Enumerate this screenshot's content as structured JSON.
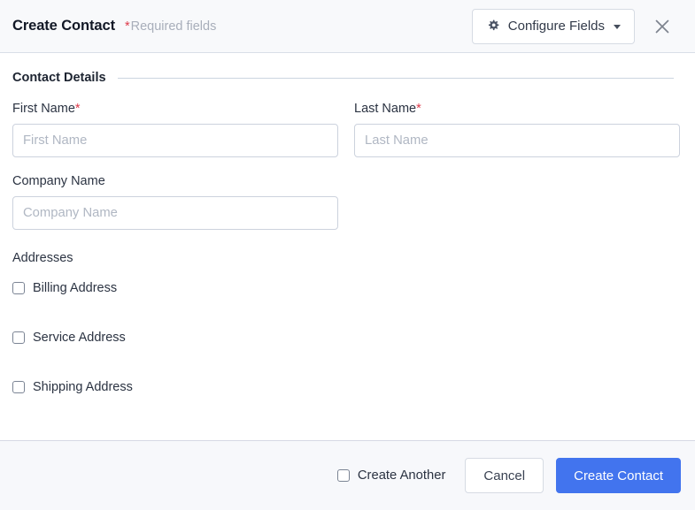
{
  "header": {
    "title": "Create Contact",
    "required_asterisk": "*",
    "required_note": "Required fields",
    "configure_label": "Configure Fields",
    "gear_icon_name": "gear-icon",
    "caret_icon_name": "chevron-down-icon",
    "close_icon_name": "close-icon"
  },
  "section": {
    "title": "Contact Details"
  },
  "fields": {
    "first_name": {
      "label": "First Name",
      "required_marker": "*",
      "placeholder": "First Name",
      "value": ""
    },
    "last_name": {
      "label": "Last Name",
      "required_marker": "*",
      "placeholder": "Last Name",
      "value": ""
    },
    "company_name": {
      "label": "Company Name",
      "placeholder": "Company Name",
      "value": ""
    }
  },
  "addresses": {
    "label": "Addresses",
    "options": [
      {
        "label": "Billing Address",
        "checked": false
      },
      {
        "label": "Service Address",
        "checked": false
      },
      {
        "label": "Shipping Address",
        "checked": false
      }
    ]
  },
  "footer": {
    "create_another_label": "Create Another",
    "create_another_checked": false,
    "cancel_label": "Cancel",
    "submit_label": "Create Contact"
  },
  "colors": {
    "primary": "#4274ee",
    "required": "#de3b4b",
    "header_bg": "#f8f9fb",
    "footer_bg": "#f7f8fb",
    "border": "#ccd2dd",
    "text": "#2b3342",
    "placeholder": "#b0b7c3"
  }
}
